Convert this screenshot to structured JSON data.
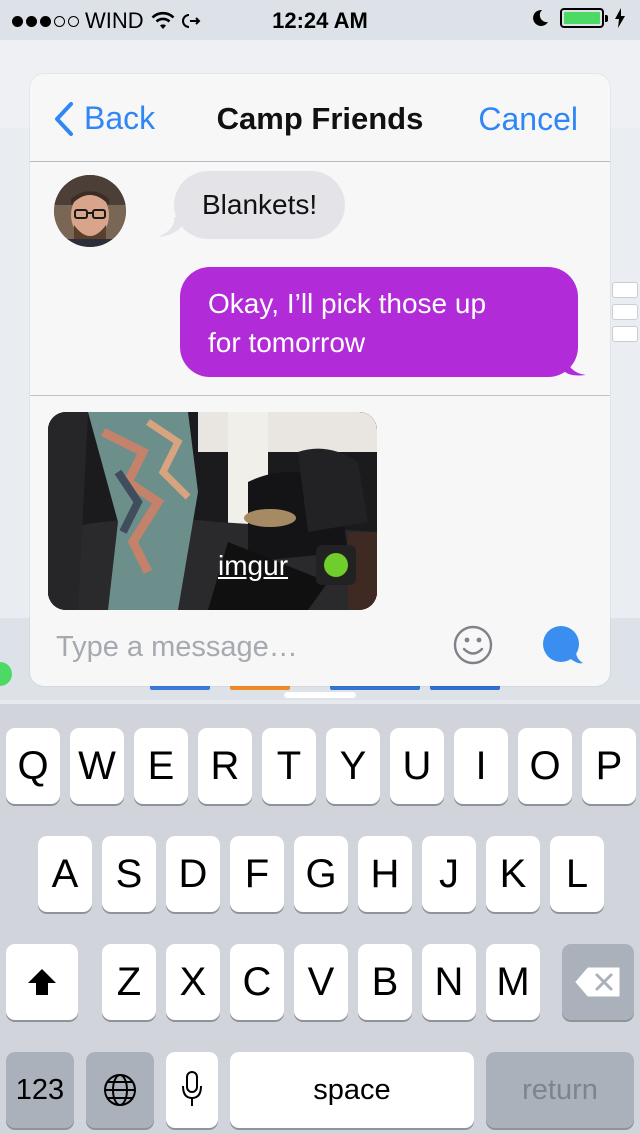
{
  "status_bar": {
    "carrier": "WIND",
    "time": "12:24 AM",
    "signal_filled": 3,
    "signal_total": 5,
    "battery_level": 1.0
  },
  "sheet": {
    "back_label": "Back",
    "title": "Camp Friends",
    "cancel_label": "Cancel"
  },
  "messages": {
    "incoming_text": "Blankets!",
    "outgoing_line1": "Okay, I’ll pick those up",
    "outgoing_line2": "for tomorrow"
  },
  "attachment": {
    "label": "imgur"
  },
  "compose": {
    "placeholder": "Type a message…"
  },
  "keyboard": {
    "row1": [
      "Q",
      "W",
      "E",
      "R",
      "T",
      "Y",
      "U",
      "I",
      "O",
      "P"
    ],
    "row2": [
      "A",
      "S",
      "D",
      "F",
      "G",
      "H",
      "J",
      "K",
      "L"
    ],
    "row3": [
      "Z",
      "X",
      "C",
      "V",
      "B",
      "N",
      "M"
    ],
    "numbers_label": "123",
    "space_label": "space",
    "return_label": "return"
  },
  "colors": {
    "accent_blue": "#2f86f5",
    "outgoing_bubble": "#b12bd8",
    "incoming_bubble": "#e4e4e8",
    "battery_green": "#4cd964"
  },
  "icons": {
    "back": "chevron-left-icon",
    "wifi": "wifi-icon",
    "moon": "moon-icon",
    "smiley": "smiley-icon",
    "send": "chat-bubble-icon",
    "shift": "shift-icon",
    "delete": "backspace-icon",
    "globe": "globe-icon",
    "mic": "microphone-icon"
  }
}
